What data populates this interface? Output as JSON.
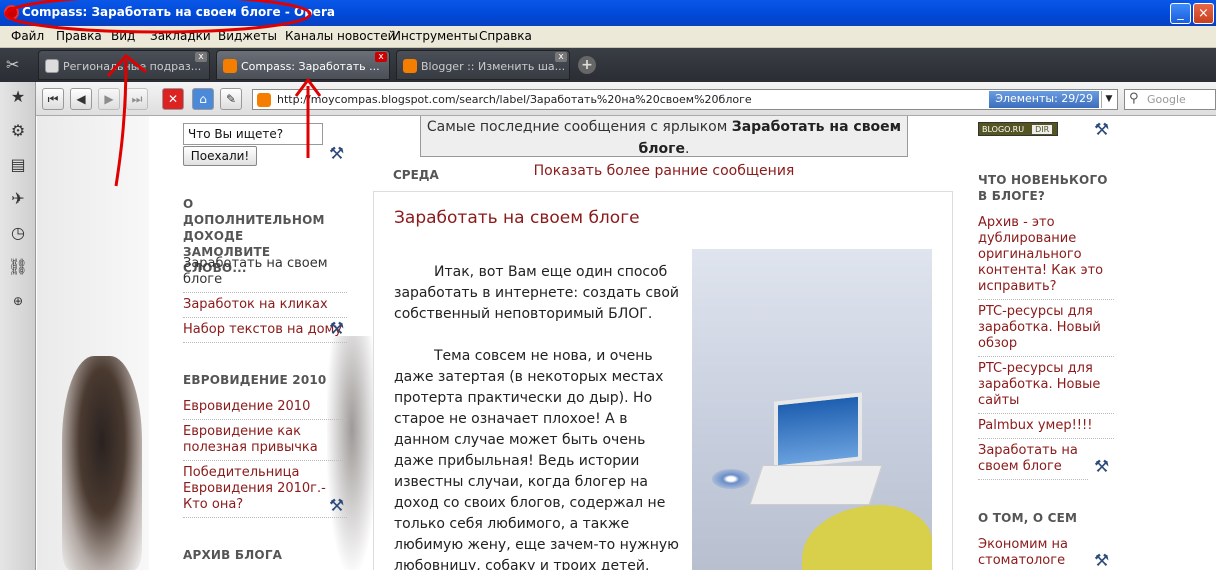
{
  "window": {
    "title": "Compass: Заработать на своем блоге - Opera",
    "controls": [
      "_",
      "×"
    ]
  },
  "menu": [
    "Файл",
    "Правка",
    "Вид",
    "Закладки",
    "Виджеты",
    "Каналы новостей",
    "Инструменты",
    "Справка"
  ],
  "tabs": [
    {
      "label": "Региональные подраз...",
      "icon": "document-icon",
      "active": false
    },
    {
      "label": "Compass: Заработать ...",
      "icon": "blogger-icon",
      "active": true
    },
    {
      "label": "Blogger :: Изменить ша...",
      "icon": "blogger-icon",
      "active": false
    }
  ],
  "tab_close": "x",
  "new_tab": "+",
  "nav": {
    "url": "http://moycompas.blogspot.com/search/label/Заработать%20на%20своем%20блоге",
    "elements": "Элементы:  29/29",
    "search_placeholder": "Google"
  },
  "side_panel_icons": [
    "tools-icon",
    "bookmarks-star-icon",
    "settings-gear-icon",
    "notes-icon",
    "transfers-icon",
    "history-clock-icon",
    "links-icon",
    "add-panel-icon"
  ],
  "blog_search": {
    "placeholder": "Что Вы ищете?",
    "button": "Поехали!"
  },
  "left_sidebar": {
    "section1": {
      "heading": "О ДОПОЛНИТЕЛЬНОМ ДОХОДЕ ЗАМОЛВИТЕ СЛОВО...",
      "links": [
        "Заработать на своем блоге",
        "Заработок на кликах",
        "Набор текстов на дому"
      ]
    },
    "section2": {
      "heading": "ЕВРОВИДЕНИЕ 2010",
      "links": [
        "Евровидение 2010",
        "Евровидение как полезная привычка",
        "Победительница Евровидения 2010г.- Кто она?"
      ]
    },
    "section3": {
      "heading": "АРХИВ БЛОГА"
    }
  },
  "banner": {
    "text": "Самые последние сообщения с ярлыком",
    "label": "Заработать на своем блоге",
    "more": "Показать более ранние сообщения"
  },
  "post": {
    "date": "СРЕДА",
    "title": "Заработать на своем блоге",
    "paragraphs": [
      "Итак, вот Вам еще один способ заработать в интернете: создать свой собственный неповторимый БЛОГ.",
      "Тема совсем не нова, и очень даже затертая (в некоторых местах протерта практически до дыр). Но старое не означает плохое! А в данном случае может быть очень даже прибыльная! Ведь истории известны случаи, когда блогер на доход со своих блогов, содержал не только себя любимого, а также любимую жену, еще зачем-то нужную любовницу, собаку и троих детей."
    ]
  },
  "right_sidebar": {
    "badge": {
      "left": "BLOGO.RU",
      "right": "DIR"
    },
    "heading1": "ЧТО НОВЕНЬКОГО В БЛОГЕ?",
    "links": [
      "Архив - это дублирование оригинального контента! Как это исправить?",
      "PTC-ресурсы для заработка. Новый обзор",
      "PTC-ресурсы для заработка. Новые сайты",
      "Palmbux умер!!!!",
      "Заработать на своем блоге"
    ],
    "heading2": "О ТОМ, О СЕМ",
    "links2": [
      "Экономим на стоматологе"
    ]
  },
  "colors": {
    "title_bar": "#0048d8",
    "link": "#8b1a1a",
    "annotation": "#e00000"
  }
}
